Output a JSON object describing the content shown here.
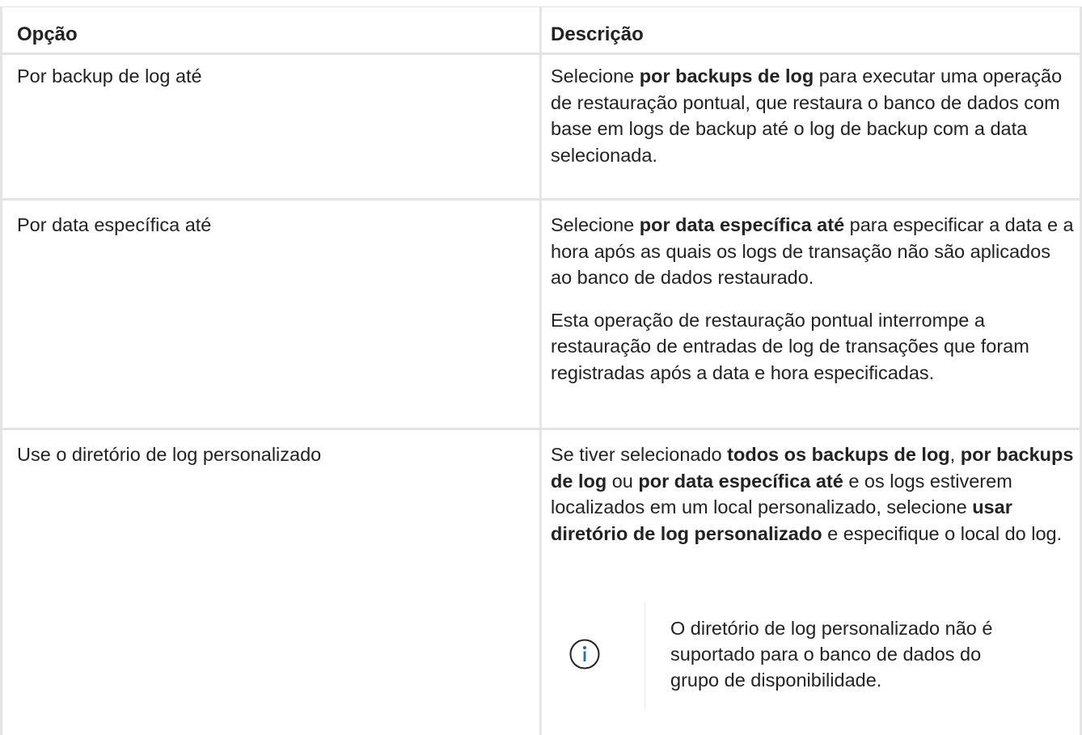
{
  "table": {
    "headers": {
      "option": "Opção",
      "description": "Descrição"
    },
    "rows": [
      {
        "option": "Por backup de log até",
        "description": [
          [
            {
              "t": "Selecione ",
              "b": false
            },
            {
              "t": "por backups de log",
              "b": true
            },
            {
              "t": " para executar uma operação de restauração pontual, que restaura o banco de dados com base em logs de backup até o log de backup com a data selecionada.",
              "b": false
            }
          ]
        ]
      },
      {
        "option": "Por data específica até",
        "description": [
          [
            {
              "t": "Selecione ",
              "b": false
            },
            {
              "t": "por data específica até",
              "b": true
            },
            {
              "t": " para especificar a data e a hora após as quais os logs de transação não são aplicados ao banco de dados restaurado.",
              "b": false
            }
          ],
          [
            {
              "t": "Esta operação de restauração pontual interrompe a restauração de entradas de log de transações que foram registradas após a data e hora especificadas.",
              "b": false
            }
          ]
        ]
      },
      {
        "option": "Use o diretório de log personalizado",
        "description": [
          [
            {
              "t": "Se tiver selecionado ",
              "b": false
            },
            {
              "t": "todos os backups de log",
              "b": true
            },
            {
              "t": ", ",
              "b": false
            },
            {
              "t": "por backups de log",
              "b": true
            },
            {
              "t": " ou ",
              "b": false
            },
            {
              "t": "por data específica até",
              "b": true
            },
            {
              "t": " e os logs estiverem localizados em um local personalizado, selecione ",
              "b": false
            },
            {
              "t": "usar diretório de log personalizado",
              "b": true
            },
            {
              "t": " e especifique o local do log.",
              "b": false
            }
          ]
        ],
        "note": {
          "icon": "info-icon",
          "text": "O diretório de log personalizado não é suportado para o banco de dados do grupo de disponibilidade."
        }
      }
    ]
  },
  "colors": {
    "border": "#e4e4e4",
    "text": "#222222",
    "icon_accent": "#1a6fc4"
  }
}
